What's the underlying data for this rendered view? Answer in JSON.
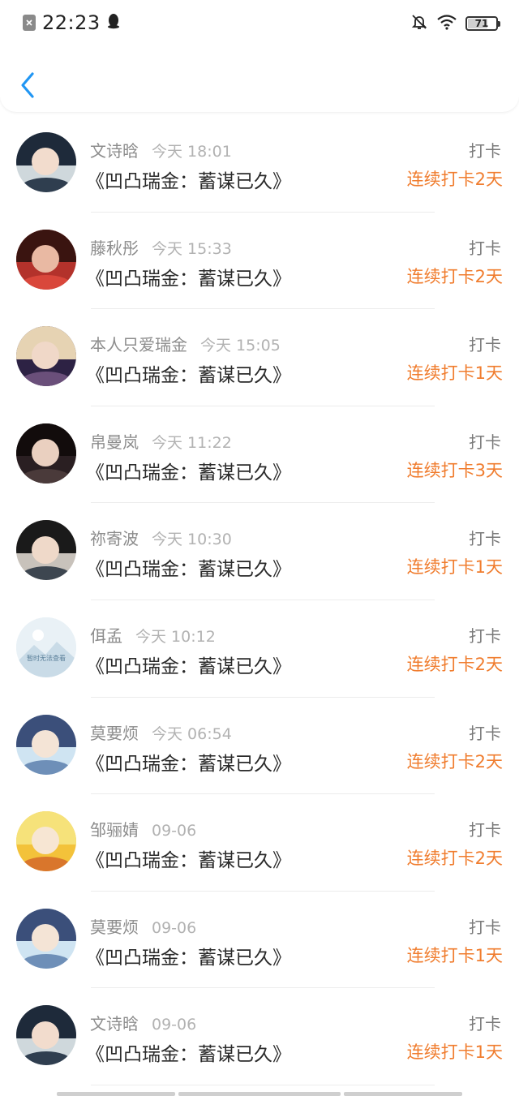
{
  "status_bar": {
    "time": "22:23",
    "battery": "71",
    "battery_level": 0.71
  },
  "items": [
    {
      "name": "文诗晗",
      "time": "今天 18:01",
      "title": "《凹凸瑞金：蓄谋已久》",
      "action": "打卡",
      "streak": "连续打卡2天",
      "avatar": {
        "bg": "#cfd8dc",
        "hair": "#1e2a3a",
        "face": "#f2dccd",
        "body": "#2f3e4f"
      }
    },
    {
      "name": "藤秋彤",
      "time": "今天 15:33",
      "title": "《凹凸瑞金：蓄谋已久》",
      "action": "打卡",
      "streak": "连续打卡2天",
      "avatar": {
        "bg": "#b3322b",
        "hair": "#3a1410",
        "face": "#e9b9a3",
        "body": "#d9473b"
      }
    },
    {
      "name": "本人只爱瑞金",
      "time": "今天 15:05",
      "title": "《凹凸瑞金：蓄谋已久》",
      "action": "打卡",
      "streak": "连续打卡1天",
      "avatar": {
        "bg": "#2d2244",
        "hair": "#e6d3b3",
        "face": "#f0d8c8",
        "body": "#6a4f7a"
      }
    },
    {
      "name": "帛曼岚",
      "time": "今天 11:22",
      "title": "《凹凸瑞金：蓄谋已久》",
      "action": "打卡",
      "streak": "连续打卡3天",
      "avatar": {
        "bg": "#2a1f22",
        "hair": "#120c0c",
        "face": "#ead0c0",
        "body": "#4a3a3a"
      }
    },
    {
      "name": "祢寄波",
      "time": "今天 10:30",
      "title": "《凹凸瑞金：蓄谋已久》",
      "action": "打卡",
      "streak": "连续打卡1天",
      "avatar": {
        "bg": "#c8c2bb",
        "hair": "#1a1a1a",
        "face": "#efd9c9",
        "body": "#3d4650"
      }
    },
    {
      "name": "佴孟",
      "time": "今天 10:12",
      "title": "《凹凸瑞金：蓄谋已久》",
      "action": "打卡",
      "streak": "连续打卡2天",
      "avatar": {
        "bg": "#e3eef4",
        "hair": "#e3eef4",
        "face": "#ffffff",
        "body": "#c2d7e4"
      }
    },
    {
      "name": "莫要烦",
      "time": "今天 06:54",
      "title": "《凹凸瑞金：蓄谋已久》",
      "action": "打卡",
      "streak": "连续打卡2天",
      "avatar": {
        "bg": "#cfe4f2",
        "hair": "#3b4f7a",
        "face": "#f4e4d6",
        "body": "#6e8fb8"
      }
    },
    {
      "name": "邹骊婧",
      "time": "09-06",
      "title": "《凹凸瑞金：蓄谋已久》",
      "action": "打卡",
      "streak": "连续打卡2天",
      "avatar": {
        "bg": "#f3c23a",
        "hair": "#f6e27a",
        "face": "#f7e6d3",
        "body": "#d9762c"
      }
    },
    {
      "name": "莫要烦",
      "time": "09-06",
      "title": "《凹凸瑞金：蓄谋已久》",
      "action": "打卡",
      "streak": "连续打卡1天",
      "avatar": {
        "bg": "#cfe4f2",
        "hair": "#3b4f7a",
        "face": "#f4e4d6",
        "body": "#6e8fb8"
      }
    },
    {
      "name": "文诗晗",
      "time": "09-06",
      "title": "《凹凸瑞金：蓄谋已久》",
      "action": "打卡",
      "streak": "连续打卡1天",
      "avatar": {
        "bg": "#cfd8dc",
        "hair": "#1e2a3a",
        "face": "#f2dccd",
        "body": "#2f3e4f"
      }
    }
  ],
  "placeholder_avatar_text": "暂时无法查看",
  "colors": {
    "accent_blue": "#2196F3",
    "streak_orange": "#F07D2F"
  }
}
